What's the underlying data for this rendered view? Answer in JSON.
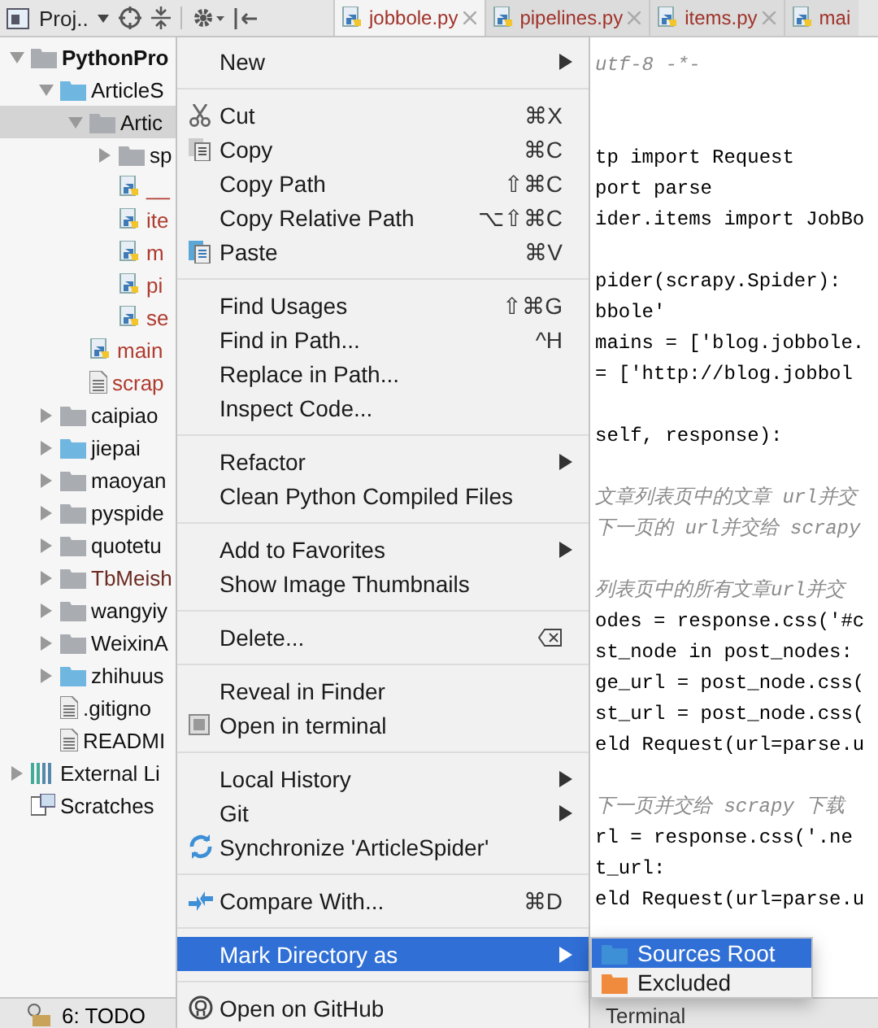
{
  "toolbar": {
    "project_label": "Proj.."
  },
  "tabs": [
    {
      "label": "jobbole.py",
      "selected": true
    },
    {
      "label": "pipelines.py",
      "selected": false
    },
    {
      "label": "items.py",
      "selected": false
    },
    {
      "label": "mai",
      "selected": false
    }
  ],
  "project_tree": [
    {
      "label": "PythonPro",
      "kind": "folder",
      "expanded": true,
      "selected": false,
      "bold": true,
      "children": [
        {
          "label": "ArticleS",
          "kind": "source-folder",
          "expanded": true,
          "selected": false,
          "children": [
            {
              "label": "Artic",
              "kind": "folder",
              "expanded": true,
              "selected": true,
              "children": [
                {
                  "label": "sp",
                  "kind": "folder",
                  "expanded": false,
                  "selected": false
                },
                {
                  "label": "__",
                  "kind": "python",
                  "selected": false,
                  "color": "#b03a2e"
                },
                {
                  "label": "ite",
                  "kind": "python",
                  "selected": false,
                  "color": "#b03a2e"
                },
                {
                  "label": "m",
                  "kind": "python",
                  "selected": false,
                  "color": "#b03a2e"
                },
                {
                  "label": "pi",
                  "kind": "python",
                  "selected": false,
                  "color": "#b03a2e"
                },
                {
                  "label": "se",
                  "kind": "python",
                  "selected": false,
                  "color": "#b03a2e"
                }
              ]
            },
            {
              "label": "main",
              "kind": "python",
              "selected": false,
              "color": "#b03a2e"
            },
            {
              "label": "scrap",
              "kind": "file",
              "selected": false,
              "color": "#b03a2e"
            }
          ]
        },
        {
          "label": "caipiao",
          "kind": "folder",
          "expanded": false,
          "selected": false
        },
        {
          "label": "jiepai",
          "kind": "source-folder",
          "expanded": false,
          "selected": false
        },
        {
          "label": "maoyan",
          "kind": "folder",
          "expanded": false,
          "selected": false
        },
        {
          "label": "pyspide",
          "kind": "folder",
          "expanded": false,
          "selected": false
        },
        {
          "label": "quotetu",
          "kind": "folder",
          "expanded": false,
          "selected": false
        },
        {
          "label": "TbMeish",
          "kind": "folder",
          "expanded": false,
          "selected": false,
          "color": "#6b2a20"
        },
        {
          "label": "wangyiy",
          "kind": "folder",
          "expanded": false,
          "selected": false
        },
        {
          "label": "WeixinA",
          "kind": "folder",
          "expanded": false,
          "selected": false
        },
        {
          "label": "zhihuus",
          "kind": "source-folder",
          "expanded": false,
          "selected": false
        },
        {
          "label": ".gitigno",
          "kind": "file",
          "selected": false
        },
        {
          "label": "READMI",
          "kind": "file",
          "selected": false
        }
      ]
    },
    {
      "label": "External Li",
      "kind": "library",
      "expanded": false,
      "selected": false
    },
    {
      "label": "Scratches",
      "kind": "scratches",
      "selected": false
    }
  ],
  "code_lines": [
    {
      "kind": "comment",
      "text": "utf-8 -*-"
    },
    {
      "kind": "gap"
    },
    {
      "kind": "gap"
    },
    {
      "kind": "code",
      "text": "tp import Request"
    },
    {
      "kind": "code",
      "text": "port parse"
    },
    {
      "kind": "code",
      "text": "ider.items import JobBo"
    },
    {
      "kind": "gap"
    },
    {
      "kind": "code",
      "text": "pider(scrapy.Spider):"
    },
    {
      "kind": "code",
      "text": "bbole'"
    },
    {
      "kind": "code",
      "text": "mains = ['blog.jobbole."
    },
    {
      "kind": "code",
      "text": " = ['http://blog.jobbol"
    },
    {
      "kind": "gap"
    },
    {
      "kind": "code",
      "text": "self, response):"
    },
    {
      "kind": "gap"
    },
    {
      "kind": "comment",
      "text": "文章列表页中的文章 url并交"
    },
    {
      "kind": "comment",
      "text": "下一页的 url并交给 scrapy"
    },
    {
      "kind": "gap"
    },
    {
      "kind": "comment",
      "text": "列表页中的所有文章url并交"
    },
    {
      "kind": "code",
      "text": "odes = response.css('#c"
    },
    {
      "kind": "code",
      "text": "st_node in post_nodes:"
    },
    {
      "kind": "code",
      "text": "ge_url = post_node.css("
    },
    {
      "kind": "code",
      "text": "st_url = post_node.css("
    },
    {
      "kind": "code",
      "text": "eld Request(url=parse.u"
    },
    {
      "kind": "gap"
    },
    {
      "kind": "comment",
      "text": "下一页并交给 scrapy 下载"
    },
    {
      "kind": "code",
      "text": "rl = response.css('.ne"
    },
    {
      "kind": "code",
      "text": "t_url:"
    },
    {
      "kind": "code",
      "text": "eld Request(url=parse.u"
    }
  ],
  "context_menu": {
    "groups": [
      {
        "items": [
          {
            "label": "New",
            "kind": "plain",
            "submenu": true,
            "selected": false
          }
        ]
      },
      {
        "items": [
          {
            "label": "Cut",
            "kind": "cut",
            "shortcut": "⌘X",
            "submenu": false,
            "selected": false
          },
          {
            "label": "Copy",
            "kind": "copy",
            "shortcut": "⌘C",
            "submenu": false,
            "selected": false
          },
          {
            "label": "Copy Path",
            "kind": "plain",
            "shortcut": "⇧⌘C",
            "submenu": false,
            "selected": false
          },
          {
            "label": "Copy Relative Path",
            "kind": "plain",
            "shortcut": "⌥⇧⌘C",
            "submenu": false,
            "selected": false
          },
          {
            "label": "Paste",
            "kind": "paste",
            "shortcut": "⌘V",
            "submenu": false,
            "selected": false
          }
        ]
      },
      {
        "items": [
          {
            "label": "Find Usages",
            "kind": "plain",
            "shortcut": "⇧⌘G",
            "submenu": false,
            "selected": false
          },
          {
            "label": "Find in Path...",
            "kind": "plain",
            "shortcut": "^H",
            "submenu": false,
            "selected": false
          },
          {
            "label": "Replace in Path...",
            "kind": "plain",
            "submenu": false,
            "selected": false
          },
          {
            "label": "Inspect Code...",
            "kind": "plain",
            "submenu": false,
            "selected": false
          }
        ]
      },
      {
        "items": [
          {
            "label": "Refactor",
            "kind": "plain",
            "submenu": true,
            "selected": false
          },
          {
            "label": "Clean Python Compiled Files",
            "kind": "plain",
            "submenu": false,
            "selected": false
          }
        ]
      },
      {
        "items": [
          {
            "label": "Add to Favorites",
            "kind": "plain",
            "submenu": true,
            "selected": false
          },
          {
            "label": "Show Image Thumbnails",
            "kind": "plain",
            "submenu": false,
            "selected": false
          }
        ]
      },
      {
        "items": [
          {
            "label": "Delete...",
            "kind": "delete",
            "submenu": false,
            "selected": false
          }
        ]
      },
      {
        "items": [
          {
            "label": "Reveal in Finder",
            "kind": "plain",
            "submenu": false,
            "selected": false
          },
          {
            "label": "Open in terminal",
            "kind": "terminal",
            "submenu": false,
            "selected": false
          }
        ]
      },
      {
        "items": [
          {
            "label": "Local History",
            "kind": "plain",
            "submenu": true,
            "selected": false
          },
          {
            "label": "Git",
            "kind": "plain",
            "submenu": true,
            "selected": false
          },
          {
            "label": "Synchronize 'ArticleSpider'",
            "kind": "sync",
            "submenu": false,
            "selected": false
          }
        ]
      },
      {
        "items": [
          {
            "label": "Compare With...",
            "kind": "compare",
            "shortcut": "⌘D",
            "submenu": false,
            "selected": false
          }
        ]
      },
      {
        "items": [
          {
            "label": "Mark Directory as",
            "kind": "plain",
            "submenu": true,
            "selected": true
          }
        ]
      },
      {
        "items": [
          {
            "label": "Open on GitHub",
            "kind": "github",
            "submenu": false,
            "selected": false
          }
        ]
      }
    ]
  },
  "submenu": {
    "items": [
      {
        "label": "Sources Root",
        "kind": "sources",
        "selected": true
      },
      {
        "label": "Excluded",
        "kind": "excluded",
        "selected": false
      }
    ]
  },
  "bottom_bar": {
    "todo": "6: TODO",
    "terminal": "Terminal"
  }
}
